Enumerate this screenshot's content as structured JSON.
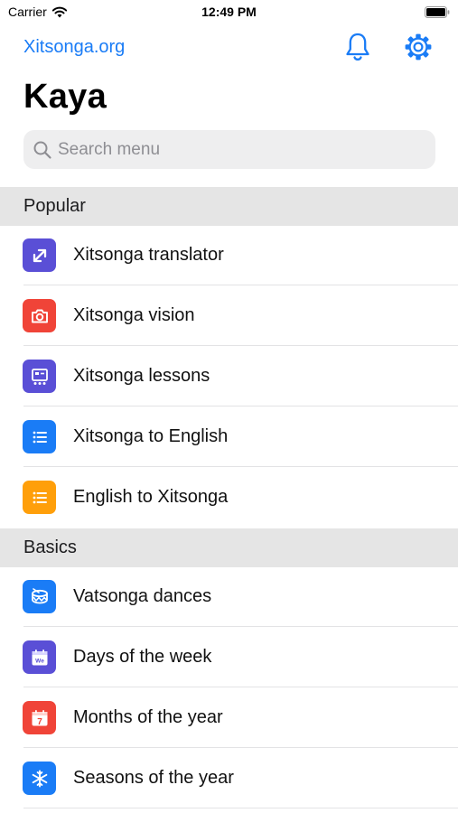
{
  "status_bar": {
    "carrier": "Carrier",
    "time": "12:49 PM"
  },
  "nav": {
    "link_label": "Xitsonga.org",
    "bell_icon": "bell-icon",
    "settings_icon": "gear-icon",
    "accent_color": "#1a7cf6"
  },
  "page": {
    "title": "Kaya"
  },
  "search": {
    "placeholder": "Search menu",
    "value": ""
  },
  "sections": [
    {
      "header": "Popular",
      "items": [
        {
          "label": "Xitsonga translator",
          "icon": "translate-arrows-icon",
          "color": "#5a4fd6"
        },
        {
          "label": "Xitsonga vision",
          "icon": "camera-icon",
          "color": "#f04438"
        },
        {
          "label": "Xitsonga lessons",
          "icon": "lessons-board-icon",
          "color": "#5a4fd6"
        },
        {
          "label": "Xitsonga to English",
          "icon": "list-icon",
          "color": "#1a7cf6"
        },
        {
          "label": "English to Xitsonga",
          "icon": "list-icon",
          "color": "#ff9f0a"
        }
      ]
    },
    {
      "header": "Basics",
      "items": [
        {
          "label": "Vatsonga dances",
          "icon": "drum-icon",
          "color": "#1a7cf6"
        },
        {
          "label": "Days of the week",
          "icon": "calendar-we-icon",
          "color": "#5a4fd6",
          "icon_text": "We"
        },
        {
          "label": "Months of the year",
          "icon": "calendar-7-icon",
          "color": "#f04438",
          "icon_text": "7"
        },
        {
          "label": "Seasons of the year",
          "icon": "snowflake-icon",
          "color": "#1a7cf6"
        }
      ]
    }
  ]
}
